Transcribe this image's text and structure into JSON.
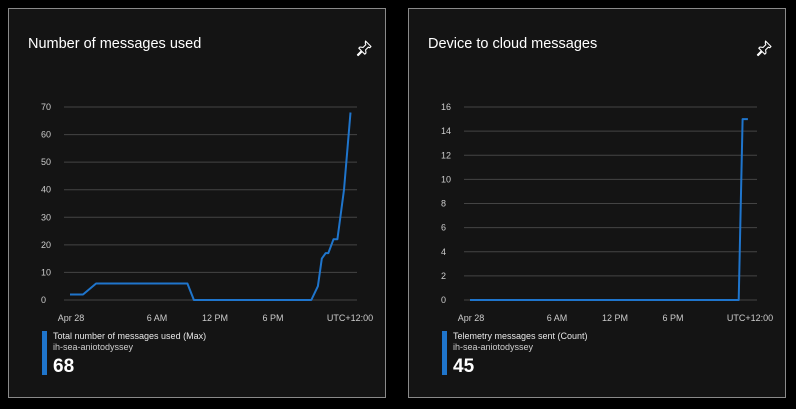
{
  "colors": {
    "series": "#1f75cc",
    "grid": "#444444",
    "tick": "#cccccc",
    "background": "#141414"
  },
  "tiles": [
    {
      "title": "Number of messages used",
      "pin_icon": "pin-icon",
      "legend": {
        "series": "Total number of messages used (Max)",
        "resource": "ih-sea-aniotodyssey",
        "value": "68"
      },
      "chart_data": {
        "type": "line",
        "title": "Number of messages used",
        "x_ticks": [
          "Apr 28",
          "6 AM",
          "12 PM",
          "6 PM",
          "UTC+12:00"
        ],
        "x": [
          0,
          1,
          2,
          4,
          9,
          9.5,
          18.5,
          19,
          19.3,
          19.6,
          19.8,
          20.2,
          20.5,
          21,
          21.5
        ],
        "values": [
          2,
          2,
          6,
          6,
          6,
          0,
          0,
          5,
          15,
          17,
          17,
          22,
          22,
          40,
          68
        ],
        "xlim": [
          0,
          22
        ],
        "y_ticks": [
          0,
          10,
          20,
          30,
          40,
          50,
          60,
          70
        ],
        "ylim": [
          0,
          70
        ],
        "grid": true
      }
    },
    {
      "title": "Device to cloud messages",
      "pin_icon": "pin-icon",
      "legend": {
        "series": "Telemetry messages sent (Count)",
        "resource": "ih-sea-aniotodyssey",
        "value": "45"
      },
      "chart_data": {
        "type": "line",
        "title": "Device to cloud messages",
        "x_ticks": [
          "Apr 28",
          "6 AM",
          "12 PM",
          "6 PM",
          "UTC+12:00"
        ],
        "x": [
          0,
          20.6,
          20.9,
          21.3
        ],
        "values": [
          0,
          0,
          15,
          15
        ],
        "xlim": [
          0,
          22
        ],
        "y_ticks": [
          0,
          2,
          4,
          6,
          8,
          10,
          12,
          14,
          16
        ],
        "ylim": [
          0,
          16
        ],
        "grid": true
      }
    }
  ]
}
